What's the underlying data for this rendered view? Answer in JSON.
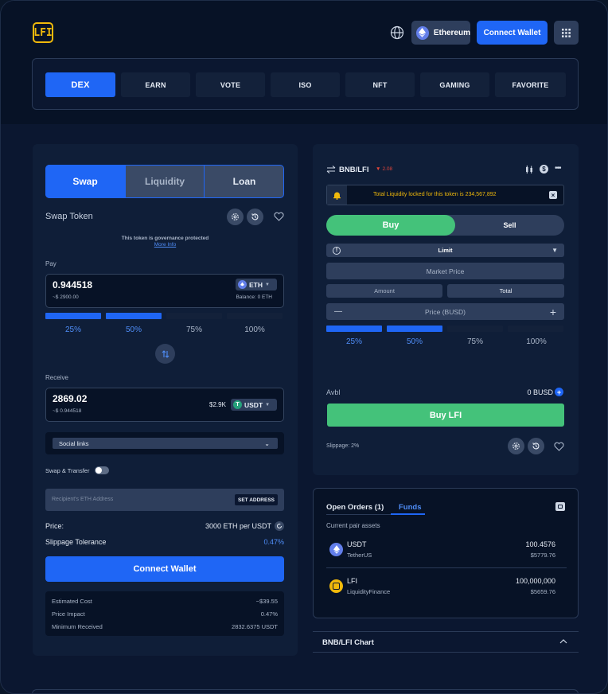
{
  "header": {
    "logo_text": "LFI",
    "network_label": "Ethereum",
    "connect_wallet_label": "Connect Wallet"
  },
  "nav": {
    "tabs": [
      "DEX",
      "EARN",
      "VOTE",
      "ISO",
      "NFT",
      "GAMING",
      "FAVORITE"
    ],
    "active": "DEX"
  },
  "swap": {
    "tabs": [
      "Swap",
      "Liquidity",
      "Loan"
    ],
    "title": "Swap Token",
    "governance_note": "This token is governance protected",
    "more_info": "More Info",
    "pay_label": "Pay",
    "pay_amount": "0.944518",
    "pay_fiat": "~$ 2900.00",
    "pay_token": "ETH",
    "pay_balance": "Balance: 0 ETH",
    "percents": [
      "25%",
      "50%",
      "75%",
      "100%"
    ],
    "filled_fraction": 0.5,
    "receive_label": "Receive",
    "receive_amount": "2869.02",
    "receive_fiat": "~$ 0.944518",
    "receive_value": "$2.9K",
    "receive_token": "USDT",
    "social_links": "Social links",
    "swap_transfer_label": "Swap & Transfer",
    "recipient_placeholder": "Recipient's ETH Address",
    "set_address": "SET ADDRESS",
    "price_label": "Price:",
    "price_value": "3000 ETH per USDT",
    "slippage_label": "Slippage Tolerance",
    "slippage_value": "0.47%",
    "connect_wallet_label": "Connect Wallet",
    "details": [
      {
        "label": "Estimated Cost",
        "value": "~$39.55"
      },
      {
        "label": "Price Impact",
        "value": "0.47%"
      },
      {
        "label": "Minimum Received",
        "value": "2832.6375 USDT"
      }
    ]
  },
  "trade": {
    "pair": "BNB/LFI",
    "change": "2.08",
    "liquidity_text": "Total Liquidity locked for this token is",
    "liquidity_value": "234,567,892",
    "buy_label": "Buy",
    "sell_label": "Sell",
    "order_type": "Limit",
    "market_price": "Market Price",
    "amount_label": "Amount",
    "total_label": "Total",
    "price_label": "Price (BUSD)",
    "minus": "—",
    "plus": "+",
    "percents": [
      "25%",
      "50%",
      "75%",
      "100%"
    ],
    "filled_fraction": 0.5,
    "avbl_label": "Avbl",
    "avbl_value": "0 BUSD",
    "buy_button": "Buy LFI",
    "slippage": "Slippage: 2%"
  },
  "orders": {
    "tab_open": "Open Orders (1)",
    "tab_funds": "Funds",
    "subtitle": "Current pair assets",
    "assets": [
      {
        "symbol": "USDT",
        "name": "TetherUS",
        "amount": "100.4576",
        "fiat": "$5779.76",
        "icon": "ethereum-icon",
        "color": "#627eea"
      },
      {
        "symbol": "LFI",
        "name": "LiquidityFinance",
        "amount": "100,000,000",
        "fiat": "$5659.76",
        "icon": "lfi-icon",
        "color": "#f0b90b"
      }
    ]
  },
  "chart_section": {
    "title": "BNB/LFI Chart"
  },
  "colors": {
    "accent": "#1f66f5",
    "buy_green": "#44c27a",
    "warning": "#f0b90b",
    "negative": "#e0453a"
  }
}
